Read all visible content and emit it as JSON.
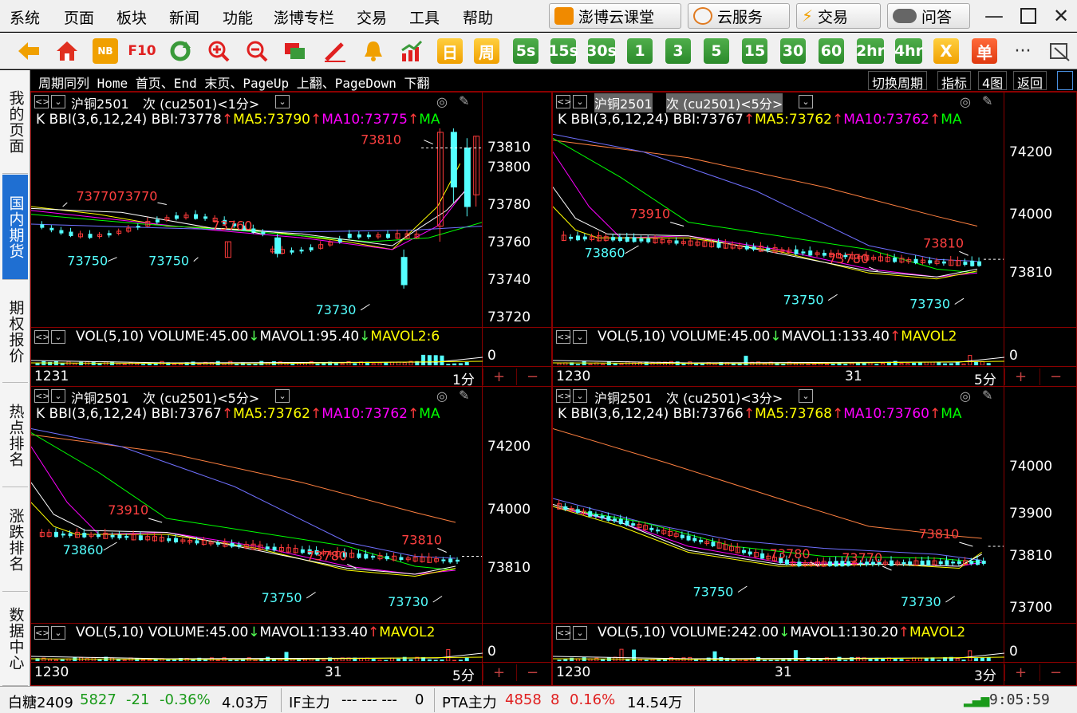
{
  "menu": [
    "系统",
    "页面",
    "板块",
    "新闻",
    "功能",
    "澎博专栏",
    "交易",
    "工具",
    "帮助"
  ],
  "top_buttons": [
    {
      "label": "澎博云课堂",
      "icon": "classroom-icon"
    },
    {
      "label": "云服务",
      "icon": "cloud-icon"
    },
    {
      "label": "交易",
      "icon": "lightning-icon"
    },
    {
      "label": "问答",
      "icon": "chat-icon"
    }
  ],
  "toolbar_periods": [
    "日",
    "周",
    "5s",
    "15s",
    "30s",
    "1",
    "3",
    "5",
    "15",
    "30",
    "60",
    "2hr",
    "4hr"
  ],
  "toolbar_x": "X",
  "toolbar_order": "单",
  "toolbar_more": "···",
  "toolbar_f10": "F10",
  "toolbar_note": "NB",
  "sidebar": [
    "我的页面",
    "国内期货",
    "期权报价",
    "热点排名",
    "涨跌排名",
    "数据中心"
  ],
  "hint": "周期同列 Home 首页、End 末页、PageUp 上翻、PageDown 下翻",
  "hint_buttons": [
    "切换周期",
    "指标",
    "4图",
    "返回"
  ],
  "panels": [
    {
      "title": "沪铜2501",
      "title_suffix": "次 (cu2501)<1分>",
      "ind_label": "K BBI(3,6,12,24) ",
      "bbi": "BBI:73778",
      "ma5": "MA5:73790",
      "ma10": "MA10:73775",
      "ma_more": "MA",
      "prices": [
        "73810",
        "73800",
        "73780",
        "73760",
        "73740",
        "73720"
      ],
      "vol_text": "VOL(5,10) VOLUME:45.00",
      "vol_mavol1": "MAVOL1:95.40",
      "vol_mavol2": "MAVOL2:6",
      "vol_zero": "0",
      "x_labels": [
        "1231"
      ],
      "period": "1分",
      "annotations": [
        "73810",
        "73770",
        "73770",
        "73760",
        "73750",
        "73750",
        "73730"
      ]
    },
    {
      "title": "沪铜2501",
      "title_suffix": "次 (cu2501)<5分>",
      "ind_label": "K BBI(3,6,12,24) ",
      "bbi": "BBI:73767",
      "ma5": "MA5:73762",
      "ma10": "MA10:73762",
      "ma_more": "MA",
      "prices": [
        "74200",
        "74000",
        "73810"
      ],
      "vol_text": "VOL(5,10) VOLUME:45.00",
      "vol_mavol1": "MAVOL1:133.40",
      "vol_mavol2": "MAVOL2",
      "vol_zero": "0",
      "x_labels": [
        "1230",
        "31"
      ],
      "period": "5分",
      "annotations": [
        "73910",
        "73860",
        "73810",
        "73780",
        "73750",
        "73730"
      ]
    },
    {
      "title": "沪铜2501",
      "title_suffix": "次 (cu2501)<5分>",
      "ind_label": "K BBI(3,6,12,24) ",
      "bbi": "BBI:73767",
      "ma5": "MA5:73762",
      "ma10": "MA10:73762",
      "ma_more": "MA",
      "prices": [
        "74200",
        "74000",
        "73810"
      ],
      "vol_text": "VOL(5,10) VOLUME:45.00",
      "vol_mavol1": "MAVOL1:133.40",
      "vol_mavol2": "MAVOL2",
      "vol_zero": "0",
      "x_labels": [
        "1230",
        "31"
      ],
      "period": "5分",
      "annotations": [
        "73910",
        "73860",
        "73810",
        "73780",
        "73750",
        "73730"
      ]
    },
    {
      "title": "沪铜2501",
      "title_suffix": "次 (cu2501)<3分>",
      "ind_label": "K BBI(3,6,12,24) ",
      "bbi": "BBI:73766",
      "ma5": "MA5:73768",
      "ma10": "MA10:73760",
      "ma_more": "MA",
      "prices": [
        "74000",
        "73900",
        "73810",
        "73700"
      ],
      "vol_text": "VOL(5,10) VOLUME:242.00",
      "vol_mavol1": "MAVOL1:130.20",
      "vol_mavol2": "MAVOL2",
      "vol_zero": "0",
      "x_labels": [
        "1230",
        "31"
      ],
      "period": "3分",
      "annotations": [
        "73810",
        "73780",
        "73770",
        "73750",
        "73730"
      ]
    }
  ],
  "plus": "+",
  "minus": "−",
  "status": {
    "s1_name": "白糖2409",
    "s1_price": "5827",
    "s1_chg": "-21",
    "s1_pct": "-0.36%",
    "s1_vol": "4.03万",
    "s2_name": "IF主力",
    "s2_vals": "---   ---   ---",
    "s2_zero": "0",
    "s3_name": "PTA主力",
    "s3_price": "4858",
    "s3_chg": "8",
    "s3_pct": "0.16%",
    "s3_vol": "14.54万",
    "clock": "9:05:59"
  },
  "colors": {
    "up": "#ff3b3b",
    "down": "#54ffff",
    "bbi": "#ffffff",
    "ma5": "#ffff00",
    "ma10": "#ff00ff",
    "ma20": "#00ff00",
    "ma60": "#7070ff",
    "ma120": "#ff8040",
    "frame": "#8b0000"
  }
}
